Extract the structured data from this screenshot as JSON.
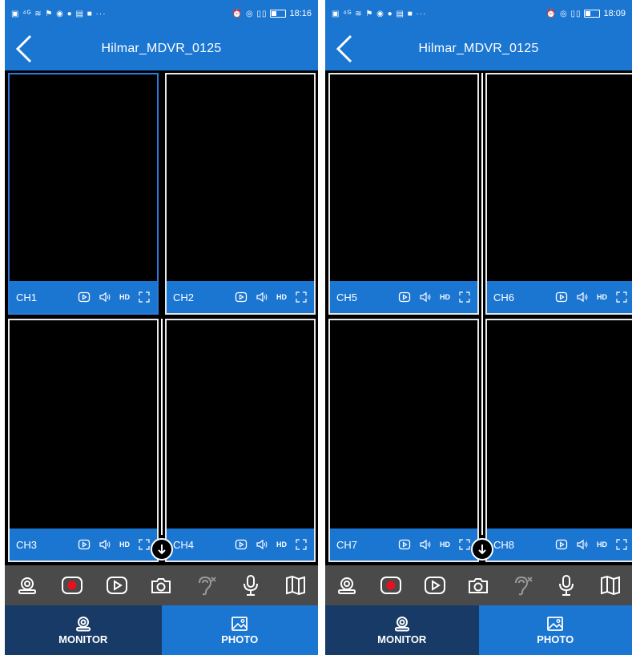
{
  "screens": [
    {
      "status": {
        "time": "18:16",
        "left_icons": "▣ ⁴ᴳ ≋ ⚑ ◉ ● ▤ ■ ···",
        "right_icons": "⏰ ◎ ▯▯"
      },
      "title": "Hilmar_MDVR_0125",
      "channels": [
        "CH1",
        "CH2",
        "CH3",
        "CH4"
      ],
      "selected_channel": "CH1"
    },
    {
      "status": {
        "time": "18:09",
        "left_icons": "▣ ⁴ᴳ ≋ ⚑ ◉ ● ▤ ■ ···",
        "right_icons": "⏰ ◎ ▯▯"
      },
      "title": "Hilmar_MDVR_0125",
      "channels": [
        "CH5",
        "CH6",
        "CH7",
        "CH8"
      ],
      "selected_channel": ""
    }
  ],
  "hd_label": "HD",
  "nav": {
    "monitor": "MONITOR",
    "photo": "PHOTO"
  },
  "toolbar_icons": [
    "camera-surveillance-icon",
    "record-icon",
    "playback-icon",
    "snapshot-icon",
    "listen-muted-icon",
    "microphone-icon",
    "map-icon"
  ],
  "colors": {
    "header": "#1b76d2",
    "toolbar": "#4a4a4a",
    "monitor_tab": "#173b66",
    "record": "#e8101b"
  }
}
